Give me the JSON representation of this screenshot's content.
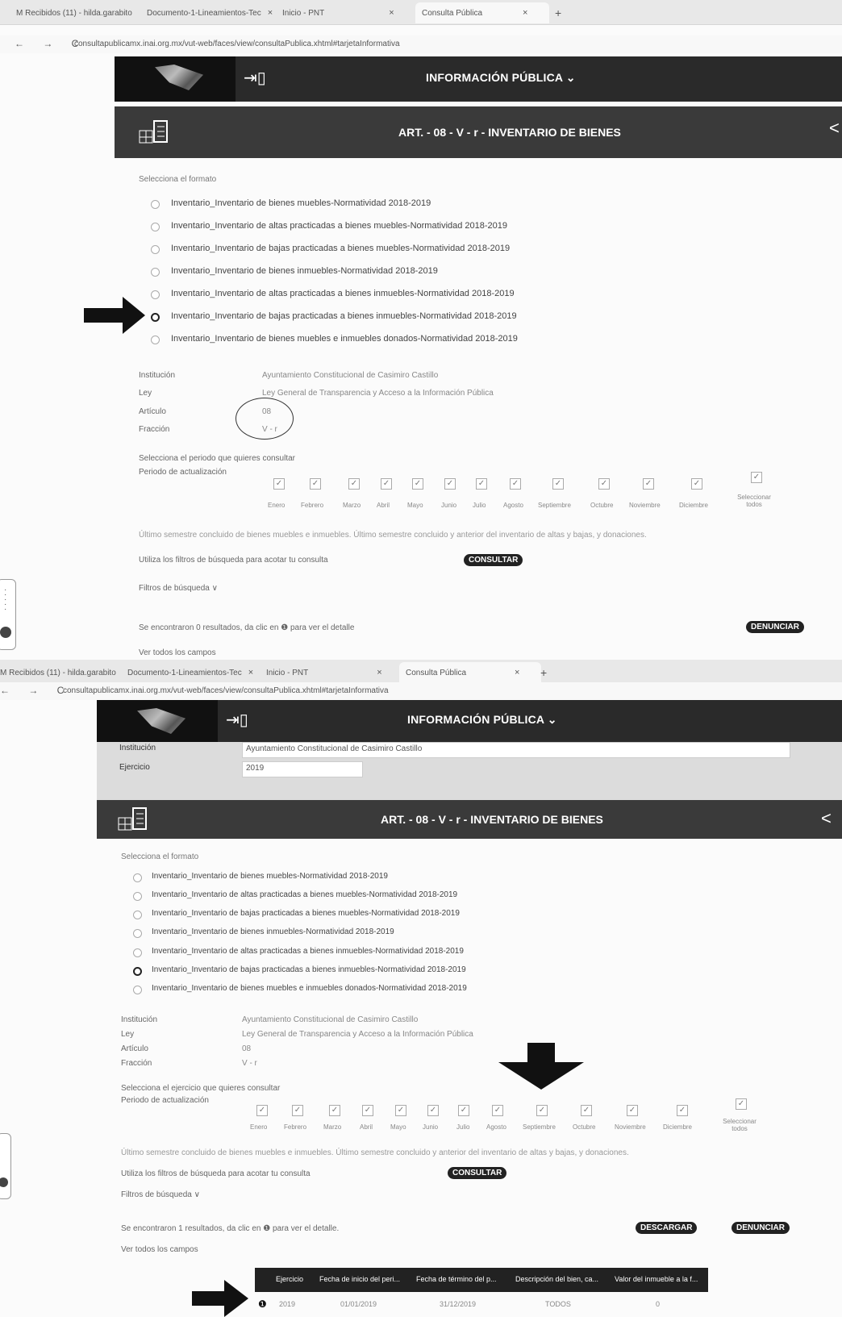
{
  "screenshot1": {
    "tabs": [
      {
        "label": "M  Recibidos (11) - hilda.garabito ",
        "close": "×"
      },
      {
        "label": "Documento-1-Lineamientos-Tec",
        "close": "×"
      },
      {
        "label": "Inicio - PNT",
        "close": "×"
      },
      {
        "label": "Consulta Pública",
        "close": "×"
      }
    ],
    "new_tab": "+",
    "nav": "← → C",
    "url": "consultapublicamx.inai.org.mx/vut-web/faces/view/consultaPublica.xhtml#tarjetaInformativa",
    "header_title": "INFORMACIÓN PÚBLICA ⌄",
    "band_title": "ART. - 08 - V - r - INVENTARIO DE BIENES",
    "select_format_label": "Selecciona el formato",
    "formats": [
      "Inventario_Inventario de bienes muebles-Normatividad 2018-2019",
      "Inventario_Inventario de altas practicadas a bienes muebles-Normatividad 2018-2019",
      "Inventario_Inventario de bajas practicadas a bienes muebles-Normatividad 2018-2019",
      "Inventario_Inventario de bienes inmuebles-Normatividad 2018-2019",
      "Inventario_Inventario de altas practicadas a bienes inmuebles-Normatividad 2018-2019",
      "Inventario_Inventario de bajas practicadas a bienes inmuebles-Normatividad 2018-2019",
      "Inventario_Inventario de bienes muebles e inmuebles donados-Normatividad 2018-2019"
    ],
    "info": {
      "institucion_label": "Institución",
      "institucion": "Ayuntamiento Constitucional de Casimiro Castillo",
      "ley_label": "Ley",
      "ley": "Ley General de Transparencia y Acceso a la Información Pública",
      "articulo_label": "Artículo",
      "articulo": "08",
      "fraccion_label": "Fracción",
      "fraccion": "V - r"
    },
    "period_prompt": "Selecciona el periodo que quieres consultar",
    "period_label": "Periodo de actualización",
    "months": [
      "Enero",
      "Febrero",
      "Marzo",
      "Abril",
      "Mayo",
      "Junio",
      "Julio",
      "Agosto",
      "Septiembre",
      "Octubre",
      "Noviembre",
      "Diciembre"
    ],
    "select_all": "Seleccionar todos",
    "note": "Último semestre concluido de bienes muebles e inmuebles. Último semestre concluido y anterior del inventario de altas y bajas, y donaciones.",
    "filters_hint": "Utiliza los filtros de búsqueda para acotar tu consulta",
    "consultar": "CONSULTAR",
    "filters_toggle": "Filtros de búsqueda ∨",
    "results": "Se encontraron 0 resultados, da clic en ❶ para ver el detalle",
    "denunciar": "DENUNCIAR",
    "ver_todos": "Ver todos los campos"
  },
  "screenshot2": {
    "tabs": [
      {
        "label": "M  Recibidos (11) - hilda.garabito ",
        "close": "×"
      },
      {
        "label": "Documento-1-Lineamientos-Tec",
        "close": "×"
      },
      {
        "label": "Inicio - PNT",
        "close": "×"
      },
      {
        "label": "Consulta Pública",
        "close": "×"
      }
    ],
    "new_tab": "+",
    "nav": "← → C",
    "url": "consultapublicamx.inai.org.mx/vut-web/faces/view/consultaPublica.xhtml#tarjetaInformativa",
    "header_title": "INFORMACIÓN PÚBLICA ⌄",
    "institucion_label": "Institución",
    "institucion_select": "Ayuntamiento Constitucional de Casimiro Castillo",
    "ejercicio_label": "Ejercicio",
    "ejercicio_select": "2019",
    "band_title": "ART. - 08 - V - r - INVENTARIO DE BIENES",
    "select_format_label": "Selecciona el formato",
    "formats": [
      "Inventario_Inventario de bienes muebles-Normatividad 2018-2019",
      "Inventario_Inventario de altas practicadas a bienes muebles-Normatividad 2018-2019",
      "Inventario_Inventario de bajas practicadas a bienes muebles-Normatividad 2018-2019",
      "Inventario_Inventario de bienes inmuebles-Normatividad 2018-2019",
      "Inventario_Inventario de altas practicadas a bienes inmuebles-Normatividad 2018-2019",
      "Inventario_Inventario de bajas practicadas a bienes inmuebles-Normatividad 2018-2019",
      "Inventario_Inventario de bienes muebles e inmuebles donados-Normatividad 2018-2019"
    ],
    "info": {
      "institucion_label": "Institución",
      "institucion": "Ayuntamiento Constitucional de Casimiro Castillo",
      "ley_label": "Ley",
      "ley": "Ley General de Transparencia y Acceso a la Información Pública",
      "articulo_label": "Artículo",
      "articulo": "08",
      "fraccion_label": "Fracción",
      "fraccion": "V - r"
    },
    "period_prompt": "Selecciona el ejercicio que quieres consultar",
    "period_label": "Periodo de actualización",
    "months": [
      "Enero",
      "Febrero",
      "Marzo",
      "Abril",
      "Mayo",
      "Junio",
      "Julio",
      "Agosto",
      "Septiembre",
      "Octubre",
      "Noviembre",
      "Diciembre"
    ],
    "select_all": "Seleccionar todos",
    "note": "Último semestre concluido de bienes muebles e inmuebles. Último semestre concluido y anterior del inventario de altas y bajas, y donaciones.",
    "filters_hint": "Utiliza los filtros de búsqueda para acotar tu consulta",
    "consultar": "CONSULTAR",
    "filters_toggle": "Filtros de búsqueda ∨",
    "results": "Se encontraron 1 resultados, da clic en ❶ para ver el detalle.",
    "descargar": "DESCARGAR",
    "denunciar": "DENUNCIAR",
    "ver_todos": "Ver todos los campos",
    "table": {
      "headers": [
        "Ejercicio",
        "Fecha de inicio del peri...",
        "Fecha de término del p...",
        "Descripción del bien, ca...",
        "Valor del inmueble a la f..."
      ],
      "row": {
        "icon": "❶",
        "ejercicio": "2019",
        "inicio": "01/01/2019",
        "termino": "31/12/2019",
        "descripcion": "TODOS",
        "valor": "0"
      }
    }
  }
}
